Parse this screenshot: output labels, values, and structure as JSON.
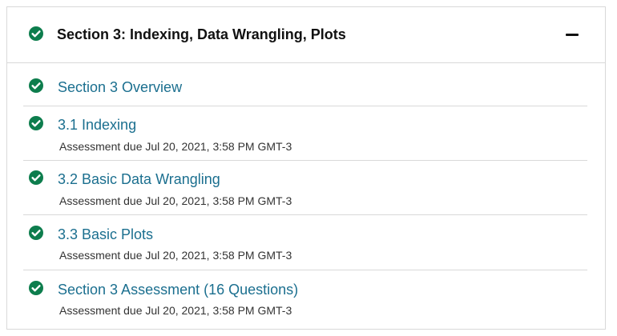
{
  "colors": {
    "check": "#0d7d4d",
    "link": "#1b6f8f",
    "border": "#d9d9d9",
    "text": "#111111"
  },
  "section": {
    "title": "Section 3: Indexing, Data Wrangling, Plots",
    "status_icon": "check-circle-icon",
    "collapse_icon": "minus-icon"
  },
  "items": [
    {
      "title": "Section 3 Overview",
      "due": ""
    },
    {
      "title": "3.1 Indexing",
      "due": "Assessment due Jul 20, 2021, 3:58 PM GMT-3"
    },
    {
      "title": "3.2 Basic Data Wrangling",
      "due": "Assessment due Jul 20, 2021, 3:58 PM GMT-3"
    },
    {
      "title": "3.3 Basic Plots",
      "due": "Assessment due Jul 20, 2021, 3:58 PM GMT-3"
    },
    {
      "title": "Section 3 Assessment (16 Questions)",
      "due": "Assessment due Jul 20, 2021, 3:58 PM GMT-3"
    }
  ]
}
